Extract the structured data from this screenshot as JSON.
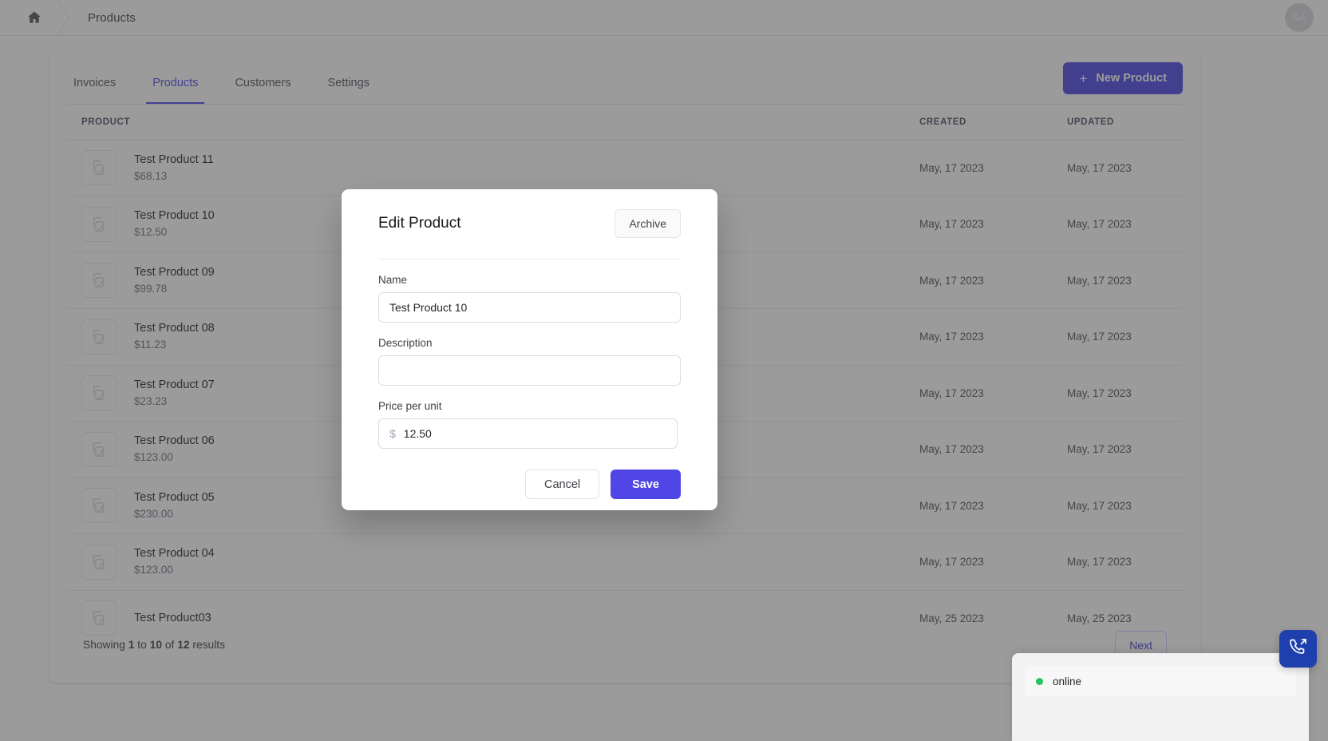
{
  "topbar": {
    "home_icon": "home-icon",
    "breadcrumb": "Products",
    "avatar_initials": "SA"
  },
  "tabs": [
    {
      "label": "Invoices",
      "active": false
    },
    {
      "label": "Products",
      "active": true
    },
    {
      "label": "Customers",
      "active": false
    },
    {
      "label": "Settings",
      "active": false
    }
  ],
  "toolbar": {
    "new_product_label": "New Product",
    "plus_icon": "plus-icon"
  },
  "table": {
    "headers": [
      "PRODUCT",
      "CREATED",
      "UPDATED"
    ],
    "rows": [
      {
        "name": "Test Product 11",
        "price": "$68.13",
        "created": "May, 17 2023",
        "updated": "May, 17 2023"
      },
      {
        "name": "Test Product 10",
        "price": "$12.50",
        "created": "May, 17 2023",
        "updated": "May, 17 2023"
      },
      {
        "name": "Test Product 09",
        "price": "$99.78",
        "created": "May, 17 2023",
        "updated": "May, 17 2023"
      },
      {
        "name": "Test Product 08",
        "price": "$11.23",
        "created": "May, 17 2023",
        "updated": "May, 17 2023"
      },
      {
        "name": "Test Product 07",
        "price": "$23.23",
        "created": "May, 17 2023",
        "updated": "May, 17 2023"
      },
      {
        "name": "Test Product 06",
        "price": "$123.00",
        "created": "May, 17 2023",
        "updated": "May, 17 2023"
      },
      {
        "name": "Test Product 05",
        "price": "$230.00",
        "created": "May, 17 2023",
        "updated": "May, 17 2023"
      },
      {
        "name": "Test Product 04",
        "price": "$123.00",
        "created": "May, 17 2023",
        "updated": "May, 17 2023"
      },
      {
        "name": "Test Product03",
        "price": "",
        "created": "May, 25 2023",
        "updated": "May, 25 2023"
      }
    ]
  },
  "footer": {
    "showing_prefix": "Showing ",
    "showing_from": "1",
    "showing_mid": " to ",
    "showing_to": "10",
    "showing_of": " of ",
    "showing_total": "12",
    "showing_suffix": " results",
    "next_label": "Next"
  },
  "modal": {
    "title": "Edit Product",
    "archive_label": "Archive",
    "name_label": "Name",
    "name_value": "Test Product 10",
    "name_placeholder": "",
    "description_label": "Description",
    "description_value": "",
    "description_placeholder": "",
    "price_label": "Price per unit",
    "price_currency": "$",
    "price_value": "12.50",
    "price_placeholder": "",
    "cancel_label": "Cancel",
    "save_label": "Save"
  },
  "widget": {
    "call_icon": "phone-outgoing-icon",
    "status_text": "online"
  },
  "colors": {
    "accent": "#4f46e5",
    "fab": "#1e40af",
    "online": "#22c55e"
  }
}
